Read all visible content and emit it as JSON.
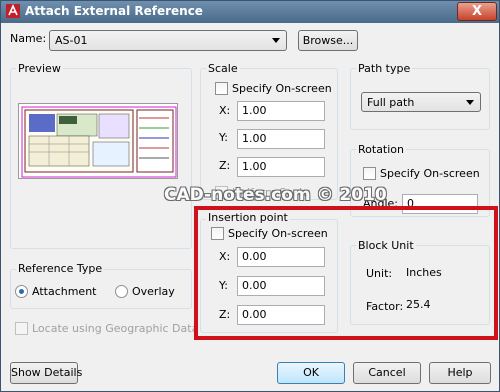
{
  "window": {
    "title": "Attach External Reference",
    "close_glyph": "X"
  },
  "name_row": {
    "label": "Name:",
    "value": "AS-01",
    "browse_label": "Browse..."
  },
  "preview": {
    "title": "Preview"
  },
  "scale": {
    "title": "Scale",
    "specify_label": "Specify On-screen",
    "x_label": "X:",
    "x_value": "1.00",
    "y_label": "Y:",
    "y_value": "1.00",
    "z_label": "Z:",
    "z_value": "1.00",
    "uniform_label": "Uniform Scale"
  },
  "insertion": {
    "title": "Insertion point",
    "specify_label": "Specify On-screen",
    "x_label": "X:",
    "x_value": "0.00",
    "y_label": "Y:",
    "y_value": "0.00",
    "z_label": "Z:",
    "z_value": "0.00"
  },
  "path_type": {
    "title": "Path type",
    "value": "Full path"
  },
  "rotation": {
    "title": "Rotation",
    "specify_label": "Specify On-screen",
    "angle_label": "Angle:",
    "angle_value": "0"
  },
  "block_unit": {
    "title": "Block Unit",
    "unit_label": "Unit:",
    "unit_value": "Inches",
    "factor_label": "Factor:",
    "factor_value": "25.4"
  },
  "reference_type": {
    "title": "Reference Type",
    "attachment_label": "Attachment",
    "overlay_label": "Overlay",
    "selected": "Attachment"
  },
  "geo": {
    "label": "Locate using Geographic Data"
  },
  "buttons": {
    "show_details": "Show Details",
    "ok": "OK",
    "cancel": "Cancel",
    "help": "Help"
  },
  "watermark": "CAD-notes.com © 2010",
  "colors": {
    "highlight": "#d0111b",
    "titlebar": "#4a6a8a"
  }
}
